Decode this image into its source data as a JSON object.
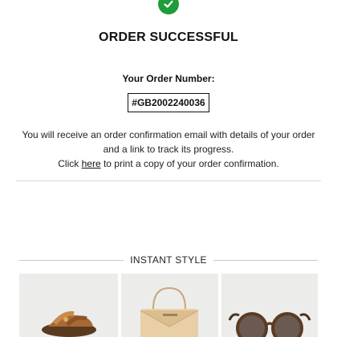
{
  "confirmation": {
    "icon": "checkmark-icon",
    "title": "ORDER SUCCESSFUL",
    "order_number_label": "Your Order Number:",
    "order_number": "#GB2002240036",
    "message_line_1": "You will receive an order confirmation email with details of your order",
    "message_line_2": "and a link to track its progress.",
    "click_text": "Click",
    "here_link": "here",
    "print_text": "to print a copy of your order confirmation."
  },
  "instant_style": {
    "heading": "INSTANT STYLE",
    "products": [
      {
        "icon": "tan-sandals-icon"
      },
      {
        "icon": "beige-crossbody-bag-icon"
      },
      {
        "icon": "round-sunglasses-icon"
      }
    ]
  },
  "colors": {
    "success_green": "#1f9d3a",
    "text": "#111111",
    "card_background": "#ececeb"
  }
}
